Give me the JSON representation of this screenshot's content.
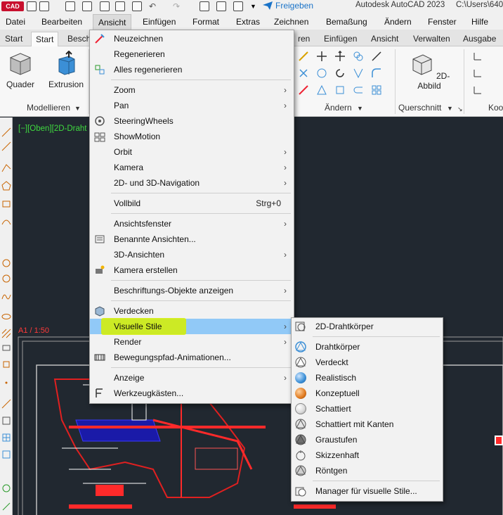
{
  "titlebar": {
    "logo": "CAD",
    "share_label": "Freigeben",
    "app_title": "Autodesk AutoCAD 2023",
    "user_path": "C:\\Users\\640"
  },
  "menubar": {
    "items": [
      "Datei",
      "Bearbeiten",
      "Ansicht",
      "Einfügen",
      "Format",
      "Extras",
      "Zeichnen",
      "Bemaßung",
      "Ändern",
      "Fenster",
      "Hilfe"
    ],
    "active": "Ansicht"
  },
  "ribbon_tabs": {
    "items": [
      "Start",
      "Start",
      "Besch",
      "ren",
      "Einfügen",
      "Ansicht",
      "Verwalten",
      "Ausgabe"
    ]
  },
  "ribbon": {
    "quader": "Quader",
    "extrusion": "Extrusion",
    "modellieren": "Modellieren",
    "aendern": "Ändern",
    "abbild": "2D-Abbild",
    "querschnitt": "Querschnitt",
    "koo": "Koo"
  },
  "canvas": {
    "viewport_label": "[−][Oben][2D-Draht",
    "layout_label": "A1 / 1:50"
  },
  "ansicht_menu": {
    "items": [
      {
        "label": "Neuzeichnen",
        "icon": "redraw-icon"
      },
      {
        "label": "Regenerieren"
      },
      {
        "label": "Alles regenerieren",
        "icon": "regen-all-icon"
      },
      {
        "label": "Zoom",
        "submenu": true
      },
      {
        "label": "Pan",
        "submenu": true
      },
      {
        "label": "SteeringWheels",
        "icon": "steering-wheel-icon"
      },
      {
        "label": "ShowMotion",
        "icon": "showmotion-icon"
      },
      {
        "label": "Orbit",
        "submenu": true
      },
      {
        "label": "Kamera",
        "submenu": true
      },
      {
        "label": "2D- und 3D-Navigation",
        "submenu": true
      },
      {
        "label": "Vollbild",
        "shortcut": "Strg+0"
      },
      {
        "label": "Ansichtsfenster",
        "submenu": true
      },
      {
        "label": "Benannte Ansichten...",
        "icon": "named-views-icon"
      },
      {
        "label": "3D-Ansichten",
        "submenu": true
      },
      {
        "label": "Kamera erstellen",
        "icon": "create-camera-icon"
      },
      {
        "label": "Beschriftungs-Objekte anzeigen",
        "submenu": true
      },
      {
        "label": "Verdecken",
        "icon": "hide-icon"
      },
      {
        "label": "Visuelle Stile",
        "submenu": true
      },
      {
        "label": "Render",
        "submenu": true
      },
      {
        "label": "Bewegungspfad-Animationen...",
        "icon": "motion-path-icon"
      },
      {
        "label": "Anzeige",
        "submenu": true
      },
      {
        "label": "Werkzeugkästen...",
        "icon": "toolbars-icon"
      }
    ]
  },
  "styles_menu": {
    "items": [
      {
        "label": "2D-Drahtkörper"
      },
      {
        "label": "Drahtkörper"
      },
      {
        "label": "Verdeckt"
      },
      {
        "label": "Realistisch"
      },
      {
        "label": "Konzeptuell"
      },
      {
        "label": "Schattiert"
      },
      {
        "label": "Schattiert mit Kanten"
      },
      {
        "label": "Graustufen"
      },
      {
        "label": "Skizzenhaft"
      },
      {
        "label": "Röntgen"
      },
      {
        "label": "Manager für visuelle Stile..."
      }
    ]
  },
  "colors": {
    "menu_hover": "#91c9f7",
    "highlight_marker": "#d6f000",
    "canvas_bg": "#212830",
    "viewport_label": "#3fd93f"
  }
}
